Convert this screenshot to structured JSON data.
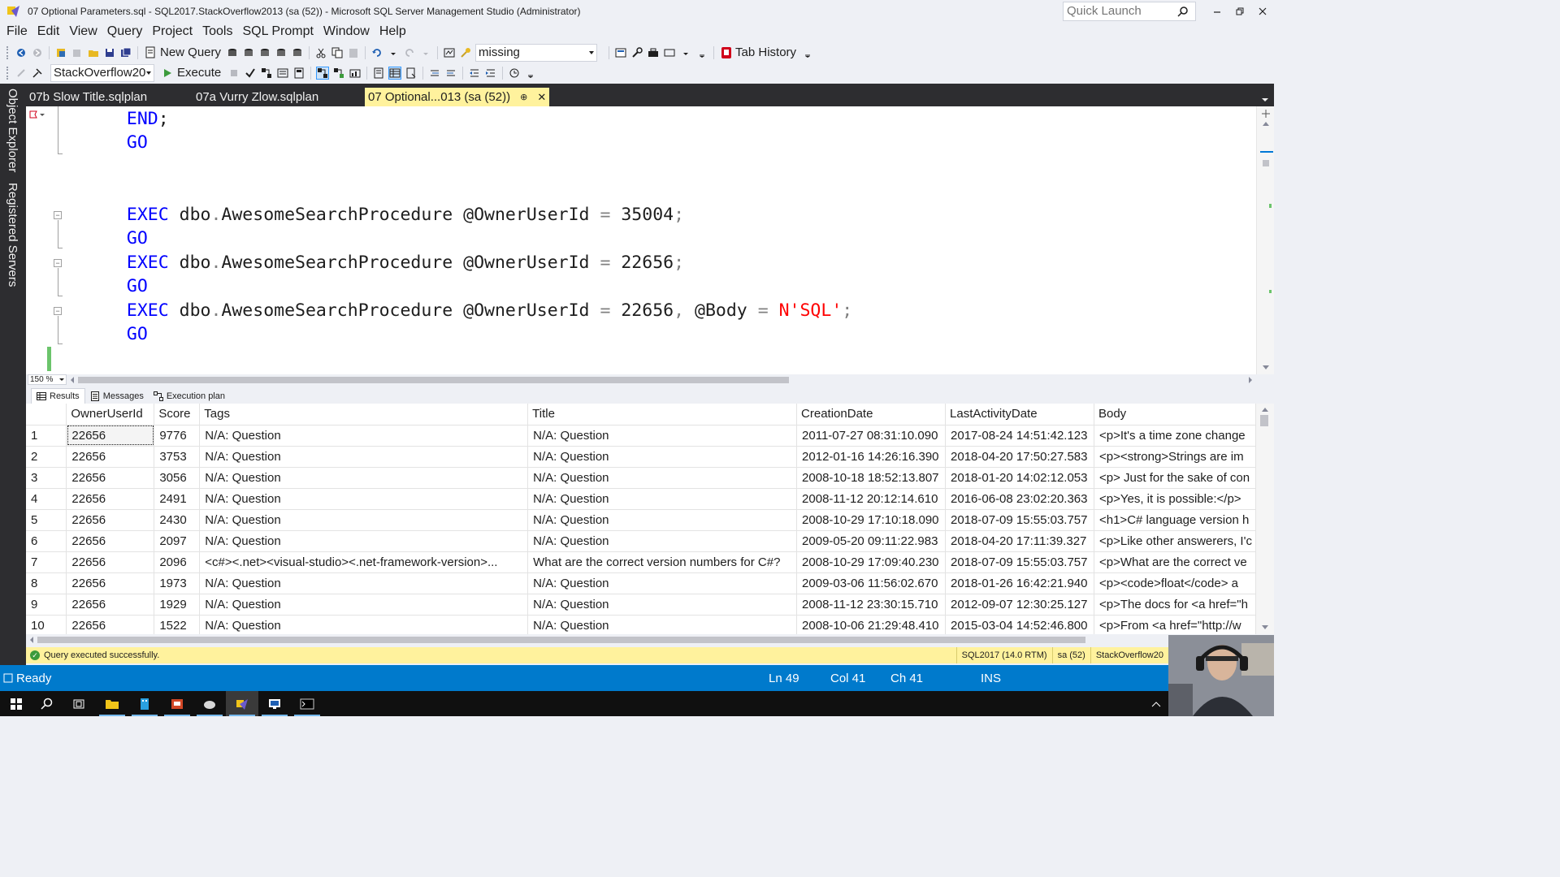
{
  "window": {
    "title": "07 Optional Parameters.sql - SQL2017.StackOverflow2013 (sa (52)) - Microsoft SQL Server Management Studio (Administrator)",
    "quick_launch_placeholder": "Quick Launch"
  },
  "menu": [
    "File",
    "Edit",
    "View",
    "Query",
    "Project",
    "Tools",
    "SQL Prompt",
    "Window",
    "Help"
  ],
  "toolbar1": {
    "new_query_label": "New Query",
    "search_combo_value": "missing",
    "tab_history_label": "Tab History"
  },
  "toolbar2": {
    "database_combo_value": "StackOverflow20",
    "execute_label": "Execute"
  },
  "left_dock": {
    "object_explorer": "Object Explorer",
    "registered_servers": "Registered Servers"
  },
  "doc_tabs": [
    {
      "label": "07b Slow Title.sqlplan",
      "active": false
    },
    {
      "label": "07a Vurry Zlow.sqlplan",
      "active": false
    },
    {
      "label": "07 Optional...013 (sa (52))",
      "active": true
    }
  ],
  "code": {
    "l1": {
      "kw": "END",
      "punct": ";"
    },
    "l2": {
      "kw": "GO"
    },
    "l3": {
      "kw": "EXEC",
      "obj1": "dbo",
      "dot": ".",
      "obj2": "AwesomeSearchProcedure",
      "param": "@OwnerUserId",
      "eq": "=",
      "value": "35004",
      "punct": ";"
    },
    "l4": {
      "kw": "GO"
    },
    "l5": {
      "kw": "EXEC",
      "obj1": "dbo",
      "dot": ".",
      "obj2": "AwesomeSearchProcedure",
      "param": "@OwnerUserId",
      "eq": "=",
      "value": "22656",
      "punct": ";"
    },
    "l6": {
      "kw": "GO"
    },
    "l7": {
      "kw": "EXEC",
      "obj1": "dbo",
      "dot": ".",
      "obj2": "AwesomeSearchProcedure",
      "param": "@OwnerUserId",
      "eq": "=",
      "value": "22656",
      "comma": ",",
      "param2": "@Body",
      "eq2": "=",
      "str": "N'SQL'",
      "punct": ";"
    },
    "l8": {
      "kw": "GO"
    }
  },
  "zoom_level": "150 %",
  "result_tabs": [
    "Results",
    "Messages",
    "Execution plan"
  ],
  "grid": {
    "columns": [
      "",
      "OwnerUserId",
      "Score",
      "Tags",
      "Title",
      "CreationDate",
      "LastActivityDate",
      "Body"
    ],
    "rows": [
      [
        "1",
        "22656",
        "9776",
        "N/A: Question",
        "N/A: Question",
        "2011-07-27 08:31:10.090",
        "2017-08-24 14:51:42.123",
        "<p>It's a time zone change"
      ],
      [
        "2",
        "22656",
        "3753",
        "N/A: Question",
        "N/A: Question",
        "2012-01-16 14:26:16.390",
        "2018-04-20 17:50:27.583",
        "<p><strong>Strings are im"
      ],
      [
        "3",
        "22656",
        "3056",
        "N/A: Question",
        "N/A: Question",
        "2008-10-18 18:52:13.807",
        "2018-01-20 14:02:12.053",
        "<p> Just for the sake of con"
      ],
      [
        "4",
        "22656",
        "2491",
        "N/A: Question",
        "N/A: Question",
        "2008-11-12 20:12:14.610",
        "2016-06-08 23:02:20.363",
        "<p>Yes, it is possible:</p>"
      ],
      [
        "5",
        "22656",
        "2430",
        "N/A: Question",
        "N/A: Question",
        "2008-10-29 17:10:18.090",
        "2018-07-09 15:55:03.757",
        "<h1>C# language version h"
      ],
      [
        "6",
        "22656",
        "2097",
        "N/A: Question",
        "N/A: Question",
        "2009-05-20 09:11:22.983",
        "2018-04-20 17:11:39.327",
        "<p>Like other answerers, I'c"
      ],
      [
        "7",
        "22656",
        "2096",
        "<c#><.net><visual-studio><.net-framework-version>...",
        "What are the correct version numbers for C#?",
        "2008-10-29 17:09:40.230",
        "2018-07-09 15:55:03.757",
        "<p>What are the correct ve"
      ],
      [
        "8",
        "22656",
        "1973",
        "N/A: Question",
        "N/A: Question",
        "2009-03-06 11:56:02.670",
        "2018-01-26 16:42:21.940",
        "<p><code>float</code> a"
      ],
      [
        "9",
        "22656",
        "1929",
        "N/A: Question",
        "N/A: Question",
        "2008-11-12 23:30:15.710",
        "2012-09-07 12:30:25.127",
        "<p>The docs for <a href=\"h"
      ],
      [
        "10",
        "22656",
        "1522",
        "N/A: Question",
        "N/A: Question",
        "2008-10-06 21:29:48.410",
        "2015-03-04 14:52:46.800",
        "<p>From <a href=\"http://w"
      ]
    ]
  },
  "query_status": {
    "message": "Query executed successfully.",
    "server_version": "SQL2017 (14.0 RTM)",
    "user": "sa (52)",
    "database": "StackOverflow20"
  },
  "status_bar": {
    "state": "Ready",
    "line": "Ln 49",
    "col": "Col 41",
    "ch": "Ch 41",
    "mode": "INS"
  },
  "colors": {
    "accent_blue": "#007acc",
    "dark_chrome": "#2d2d30",
    "active_tab_yellow": "#fff29d",
    "sql_keyword": "#0000ff",
    "sql_string": "#ff0000"
  }
}
